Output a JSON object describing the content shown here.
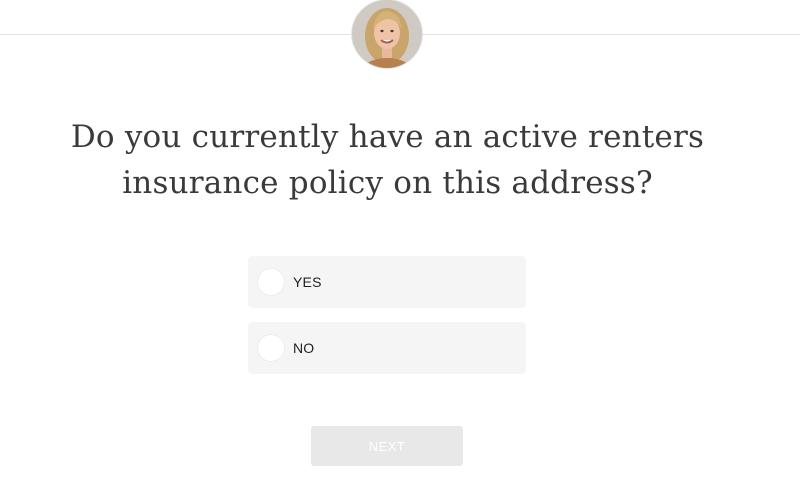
{
  "question": {
    "line1": "Do you currently have an active renters",
    "line2": "insurance policy on this address?"
  },
  "options": [
    {
      "label": "YES",
      "selected": false
    },
    {
      "label": "NO",
      "selected": false
    }
  ],
  "next_button": {
    "label": "NEXT",
    "enabled": false
  },
  "colors": {
    "option_background": "#f5f5f5",
    "button_disabled": "#e8e8e8",
    "text": "#3a3a3a"
  }
}
